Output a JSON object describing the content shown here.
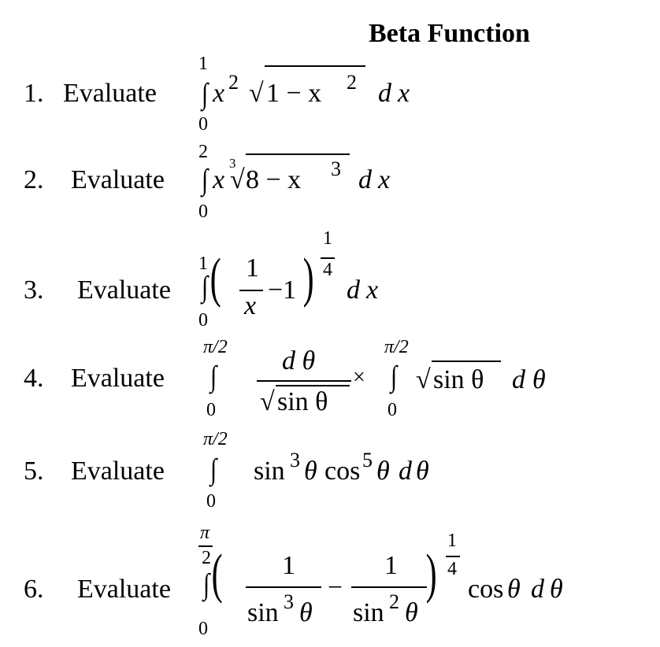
{
  "title": "Beta Function",
  "problems": [
    {
      "number": "1.",
      "verb": "Evaluate",
      "lower": "0",
      "upper": "1",
      "parts": {
        "a": "x",
        "a_exp": "2",
        "root_content": "1 − x",
        "root_exp": "2",
        "d": "d",
        "var": "x"
      }
    },
    {
      "number": "2.",
      "verb": "Evaluate",
      "lower": "0",
      "upper": "2",
      "parts": {
        "a": "x",
        "root_index": "3",
        "root_content": "8 − x",
        "root_exp": "3",
        "d": "d",
        "var": "x"
      }
    },
    {
      "number": "3.",
      "verb": "Evaluate",
      "lower": "0",
      "upper": "1",
      "parts": {
        "num": "1",
        "den": "x",
        "minus": "−1",
        "exp_num": "1",
        "exp_den": "4",
        "d": "d",
        "var": "x"
      }
    },
    {
      "number": "4.",
      "verb": "Evaluate",
      "lower": "0",
      "upper": "π/2",
      "parts": {
        "num": "d θ",
        "den": "sin  θ",
        "times": "×",
        "lower2": "0",
        "upper2": "π/2",
        "root_content": "sin  θ",
        "d": "d",
        "var": "θ"
      }
    },
    {
      "number": "5.",
      "verb": "Evaluate",
      "lower": "0",
      "upper": "π/2",
      "parts": {
        "sin": "sin",
        "sin_exp": "3",
        "theta1": "θ",
        "cos": "cos",
        "cos_exp": "5",
        "theta2": "θ",
        "d": "d",
        "var": "θ"
      }
    },
    {
      "number": "6.",
      "verb": "Evaluate",
      "lower": "0",
      "upper_num": "π",
      "upper_den": "2",
      "parts": {
        "num1": "1",
        "den1_fn": "sin",
        "den1_exp": "3",
        "den1_var": "θ",
        "minus": "−",
        "num2": "1",
        "den2_fn": "sin",
        "den2_exp": "2",
        "den2_var": "θ",
        "exp_num": "1",
        "exp_den": "4",
        "cos": "cos",
        "theta": "θ",
        "d": "d",
        "var": "θ"
      }
    }
  ]
}
